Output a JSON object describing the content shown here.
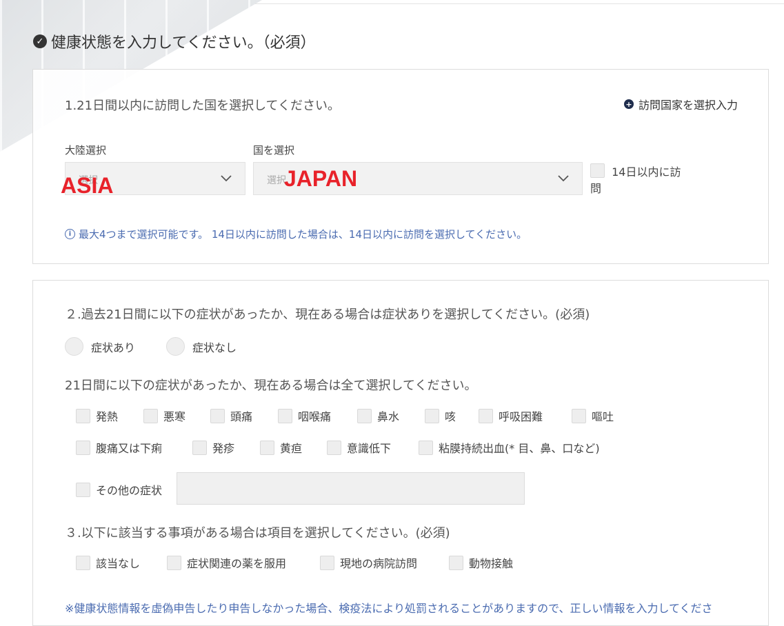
{
  "title": "健康状態を入力してください。（必須）",
  "section1": {
    "question": "1.21日間以内に訪問した国を選択してください。",
    "add_link": "訪問国家を選択入力",
    "continent_label": "大陸選択",
    "continent_placeholder": "選択",
    "continent_overlay": "ASIA",
    "country_label": "国を選択",
    "country_placeholder": "選択",
    "country_overlay": "JAPAN",
    "visited14_label_line1": "14日以内に訪",
    "visited14_label_line2": "問",
    "info": "最大4つまで選択可能です。 14日以内に訪問した場合は、14日以内に訪問を選択してください。"
  },
  "section2": {
    "question": "２.過去21日間に以下の症状があったか、現在ある場合は症状ありを選択してください。(必須)",
    "radio_yes": "症状あり",
    "radio_no": "症状なし",
    "sub_question": "21日間に以下の症状があったか、現在ある場合は全て選択してください。",
    "symptoms_row1": [
      "発熱",
      "悪寒",
      "頭痛",
      "咽喉痛",
      "鼻水",
      "咳",
      "呼吸困難",
      "嘔吐"
    ],
    "symptoms_row2": [
      "腹痛又は下痢",
      "発疹",
      "黄疸",
      "意識低下",
      "粘膜持続出血(* 目、鼻、口など)"
    ],
    "other_label": "その他の症状"
  },
  "section3": {
    "question": "３.以下に該当する事項がある場合は項目を選択してください。(必須)",
    "options": [
      "該当なし",
      "症状関連の薬を服用",
      "現地の病院訪問",
      "動物接触"
    ],
    "warning": "※健康状態情報を虚偽申告したり申告しなかった場合、検疫法により処罰されることがありますので、正しい情報を入力してくださ"
  },
  "colors": {
    "accent_blue": "#4a6bb0",
    "overlay_red": "#e8222a",
    "dark_navy": "#1f2d4d"
  }
}
